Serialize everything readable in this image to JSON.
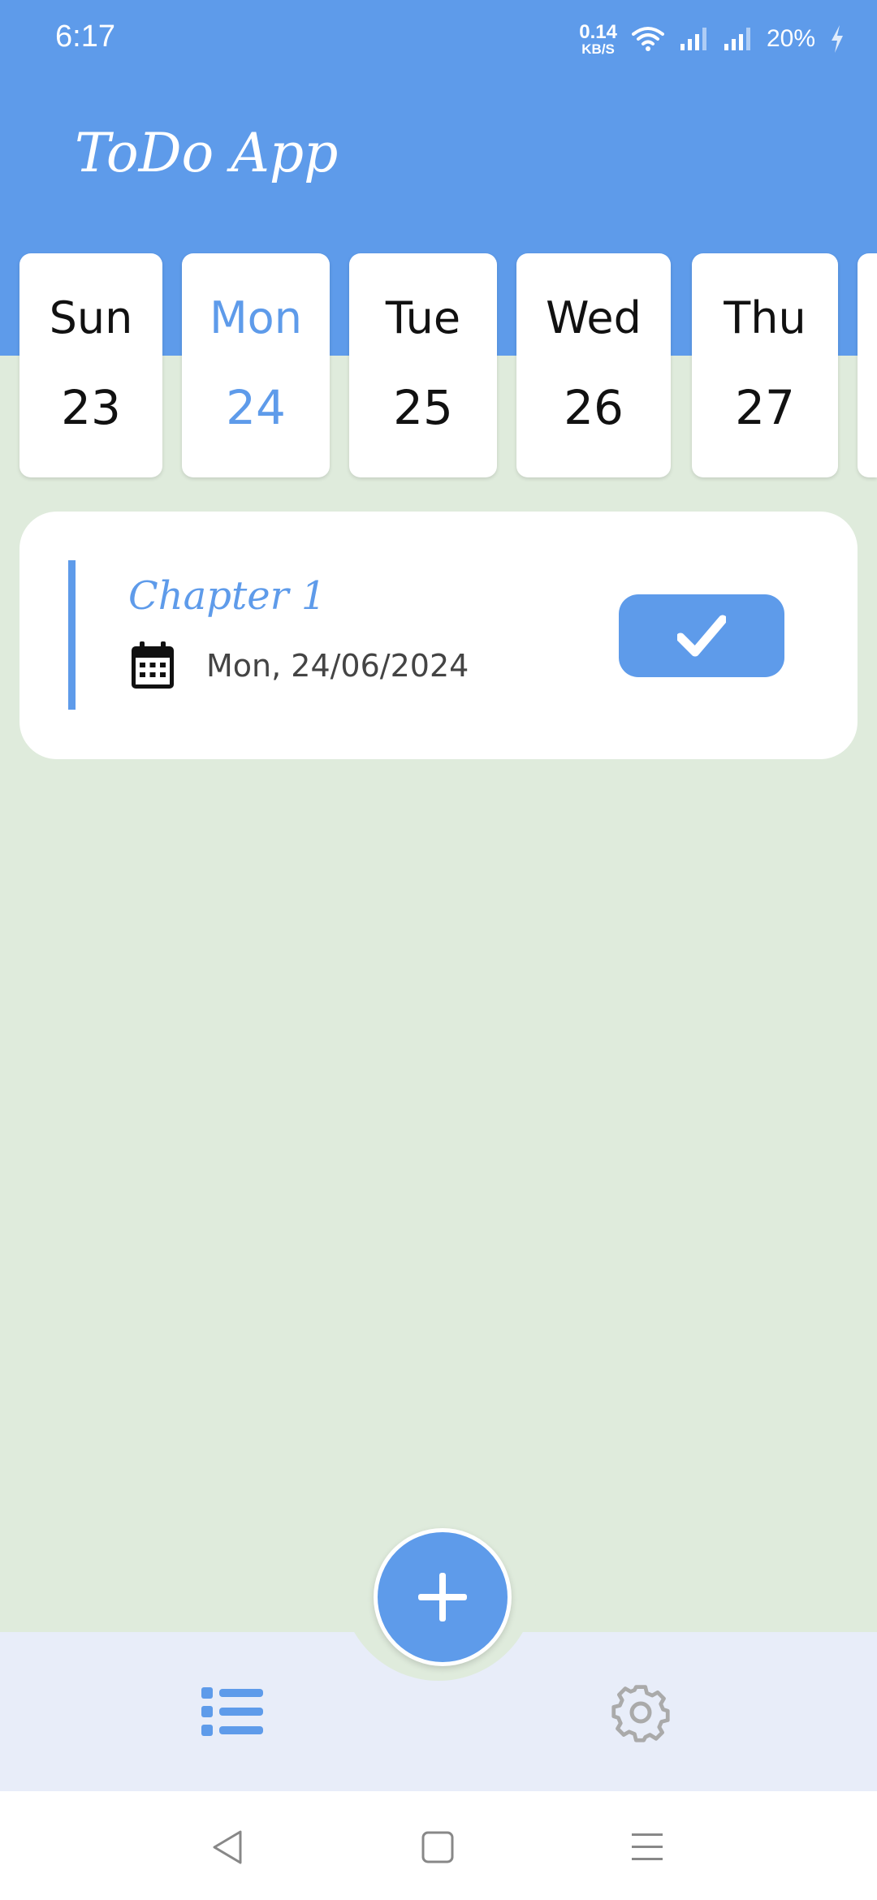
{
  "status_bar": {
    "time": "6:17",
    "speed_value": "0.14",
    "speed_unit": "KB/S",
    "battery": "20%"
  },
  "header": {
    "title": "ToDo App"
  },
  "days": [
    {
      "name": "Sun",
      "num": "23",
      "selected": false
    },
    {
      "name": "Mon",
      "num": "24",
      "selected": true
    },
    {
      "name": "Tue",
      "num": "25",
      "selected": false
    },
    {
      "name": "Wed",
      "num": "26",
      "selected": false
    },
    {
      "name": "Thu",
      "num": "27",
      "selected": false
    }
  ],
  "task": {
    "title": "Chapter 1",
    "date": "Mon, 24/06/2024"
  },
  "colors": {
    "accent": "#5E9BEA",
    "background": "#DFEBDC",
    "nav_background": "#E8EDF9"
  },
  "icons": {
    "calendar": "calendar-icon",
    "check": "check-icon",
    "add": "plus-icon",
    "list": "list-icon",
    "settings": "gear-icon"
  }
}
